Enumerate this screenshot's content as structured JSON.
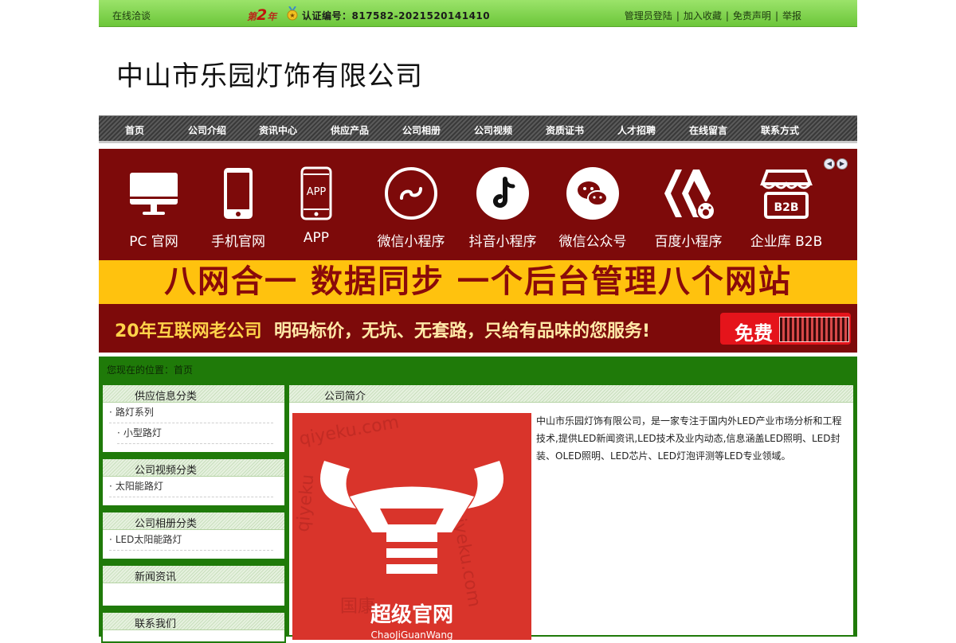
{
  "topbar": {
    "online": "在线洽谈",
    "years_prefix": "第",
    "years_num": "2",
    "years_suffix": "年",
    "cert": "认证编号：817582-2021520141410",
    "links": [
      "管理员登陆",
      "加入收藏",
      "免责声明",
      "举报"
    ]
  },
  "header": {
    "title": "中山市乐园灯饰有限公司"
  },
  "nav": [
    "首页",
    "公司介绍",
    "资讯中心",
    "供应产品",
    "公司相册",
    "公司视频",
    "资质证书",
    "人才招聘",
    "在线留言",
    "联系方式"
  ],
  "banner": {
    "services": [
      {
        "label": "PC 官网",
        "icon": "monitor-icon"
      },
      {
        "label": "手机官网",
        "icon": "phone-icon"
      },
      {
        "label": "APP",
        "icon": "app-phone-icon",
        "icon_text": "APP"
      },
      {
        "label": "微信小程序",
        "icon": "mini-program-icon"
      },
      {
        "label": "抖音小程序",
        "icon": "tiktok-icon"
      },
      {
        "label": "微信公众号",
        "icon": "wechat-icon"
      },
      {
        "label": "百度小程序",
        "icon": "baidu-mini-icon"
      },
      {
        "label": "企业库 B2B",
        "icon": "b2b-store-icon",
        "icon_text": "B2B"
      }
    ],
    "slogan": "八网合一  数据同步  一个后台管理八个网站",
    "promo_years": "20年互联网老公司",
    "promo_text": "明码标价，无坑、无套路，只给有品味的您服务!",
    "free": "免费",
    "colors": {
      "background": "#7d0a0a",
      "slogan_bg": "#ffc20e",
      "free_bg": "#e5141b"
    }
  },
  "breadcrumb": "您现在的位置：首页",
  "sidebar": [
    {
      "title": "供应信息分类",
      "items": [
        "路灯系列",
        "小型路灯"
      ]
    },
    {
      "title": "公司视频分类",
      "items": [
        "太阳能路灯"
      ]
    },
    {
      "title": "公司相册分类",
      "items": [
        "LED太阳能路灯"
      ]
    },
    {
      "title": "新闻资讯",
      "items": []
    },
    {
      "title": "联系我们",
      "items": []
    }
  ],
  "main": {
    "title": "公司简介",
    "intro": "中山市乐园灯饰有限公司，是一家专注于国内外LED产业市场分析和工程技术,提供LED新闻资讯,LED技术及业内动态,信息涵盖LED照明、LED封装、OLED照明、LED芯片、LED灯泡评测等LED专业领域。",
    "logo_text": "超级官网",
    "logo_sub": "ChaoJiGuanWang"
  },
  "colors": {
    "topbar": "#6cc63a",
    "content_bg": "#1f7a09"
  }
}
